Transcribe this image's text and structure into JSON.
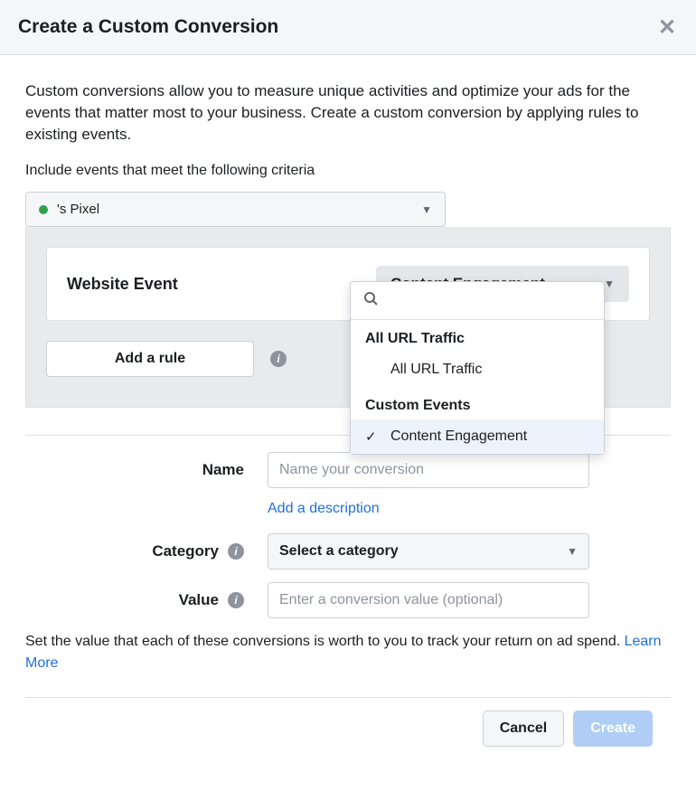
{
  "header": {
    "title": "Create a Custom Conversion"
  },
  "desc": "Custom conversions allow you to measure unique activities and optimize your ads for the events that matter most to your business. Create a custom conversion by applying rules to existing events.",
  "include_label": "Include events that meet the following criteria",
  "pixel": {
    "name": "'s Pixel"
  },
  "event": {
    "label": "Website Event",
    "selected": "Content Engagement",
    "search_placeholder": "",
    "groups": [
      {
        "header": "All URL Traffic",
        "items": [
          {
            "label": "All URL Traffic",
            "selected": false
          }
        ]
      },
      {
        "header": "Custom Events",
        "items": [
          {
            "label": "Content Engagement",
            "selected": true
          }
        ]
      }
    ]
  },
  "add_rule": "Add a rule",
  "fields": {
    "name": {
      "label": "Name",
      "placeholder": "Name your conversion"
    },
    "add_desc": "Add a description",
    "category": {
      "label": "Category",
      "placeholder": "Select a category"
    },
    "value": {
      "label": "Value",
      "placeholder": "Enter a conversion value (optional)"
    }
  },
  "value_help": {
    "text": "Set the value that each of these conversions is worth to you to track your return on ad spend. ",
    "link": "Learn More"
  },
  "footer": {
    "cancel": "Cancel",
    "create": "Create"
  }
}
